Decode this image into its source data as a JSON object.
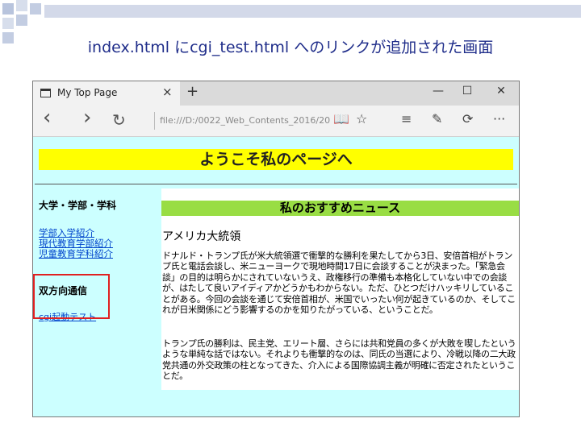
{
  "slide": {
    "title": "index.html にcgi_test.html へのリンクが追加された画面"
  },
  "browser": {
    "tab_title": "My Top Page",
    "tab_close_icon": "×",
    "new_tab_icon": "+",
    "minimize_icon": "—",
    "maximize_icon": "☐",
    "close_icon": "✕",
    "back_icon": "‹",
    "forward_icon": "›",
    "refresh_icon": "↻",
    "address": "file:///D:/0022_Web_Contents_2016/20",
    "reading_view_icon": "📖",
    "favorite_icon": "☆",
    "hub_icon": "≡",
    "note_icon": "✎",
    "share_icon": "⟳",
    "more_icon": "···"
  },
  "page": {
    "banner": "ようこそ私のページへ",
    "sidebar": {
      "heading1": "大学・学部・学科",
      "links": [
        "学部入学紹介",
        "現代教育学部紹介",
        "児童教育学科紹介"
      ],
      "heading2": "双方向通信",
      "cgi_link": "cgi起動テスト"
    },
    "news": {
      "heading": "私のおすすめニュース",
      "title": "アメリカ大統領",
      "para1": "ドナルド・トランプ氏が米大統領選で衝撃的な勝利を果たしてから3日、安倍首相がトランプ氏と電話会談し、米ニューヨークで現地時間17日に会談することが決まった。「緊急会談」の目的は明らかにされていないうえ、政権移行の準備も本格化していない中での会談が、はたして良いアイディアかどうかもわからない。ただ、ひとつだけハッキリしていることがある。今回の会談を通じて安倍首相が、米国でいったい何が起きているのか、そしてこれが日米関係にどう影響するのかを知りたがっている、ということだ。",
      "para2": "トランプ氏の勝利は、民主党、エリート層、さらには共和党員の多くが大敗を喫したというような単純な話ではない。それよりも衝撃的なのは、同氏の当選により、冷戦以降の二大政党共通の外交政策の柱となってきた、介入による国際協調主義が明確に否定されたということだ。"
    }
  }
}
